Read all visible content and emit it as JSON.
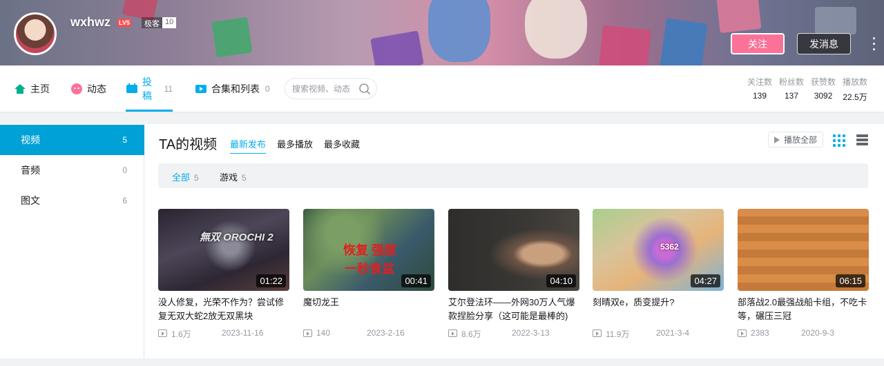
{
  "user": {
    "name": "wxhwz",
    "level": "LV5",
    "tag": "极客",
    "tag_count": "10"
  },
  "actions": {
    "follow": "关注",
    "message": "发消息"
  },
  "nav": {
    "items": [
      {
        "label": "主页",
        "count": ""
      },
      {
        "label": "动态",
        "count": ""
      },
      {
        "label": "投稿",
        "count": "11"
      },
      {
        "label": "合集和列表",
        "count": "0"
      }
    ],
    "search_placeholder": "搜索视频、动态"
  },
  "stats": [
    {
      "label": "关注数",
      "value": "139"
    },
    {
      "label": "粉丝数",
      "value": "137"
    },
    {
      "label": "获赞数",
      "value": "3092"
    },
    {
      "label": "播放数",
      "value": "22.5万"
    }
  ],
  "sidebar": {
    "items": [
      {
        "label": "视频",
        "count": "5"
      },
      {
        "label": "音频",
        "count": "0"
      },
      {
        "label": "图文",
        "count": "6"
      }
    ]
  },
  "section": {
    "title": "TA的视频",
    "sort_tabs": [
      "最新发布",
      "最多播放",
      "最多收藏"
    ],
    "play_all": "播放全部"
  },
  "filters": [
    {
      "label": "全部",
      "count": "5"
    },
    {
      "label": "游戏",
      "count": "5"
    }
  ],
  "videos": [
    {
      "title": "没人修复，光荣不作为？尝试修复无双大蛇2放无双黑块",
      "duration": "01:22",
      "plays": "1.6万",
      "date": "2023-11-16",
      "thumb_text": "無双 OROCHI 2"
    },
    {
      "title": "魔切龙王",
      "duration": "00:41",
      "plays": "140",
      "date": "2023-2-16",
      "thumb_text_1": "恢复 强度",
      "thumb_text_2": "一秒食盆"
    },
    {
      "title": "艾尔登法环——外网30万人气爆款捏脸分享（这可能是最棒的)",
      "duration": "04:10",
      "plays": "8.6万",
      "date": "2022-3-13"
    },
    {
      "title": "刻晴双e，质变提升?",
      "duration": "04:27",
      "plays": "11.9万",
      "date": "2021-3-4",
      "thumb_text": "5362"
    },
    {
      "title": "部落战2.0最强战船卡组，不吃卡等，碾压三冠",
      "duration": "06:15",
      "plays": "2383",
      "date": "2020-9-3"
    }
  ],
  "colors": {
    "accent": "#00aeec",
    "follow": "#fb7299"
  }
}
